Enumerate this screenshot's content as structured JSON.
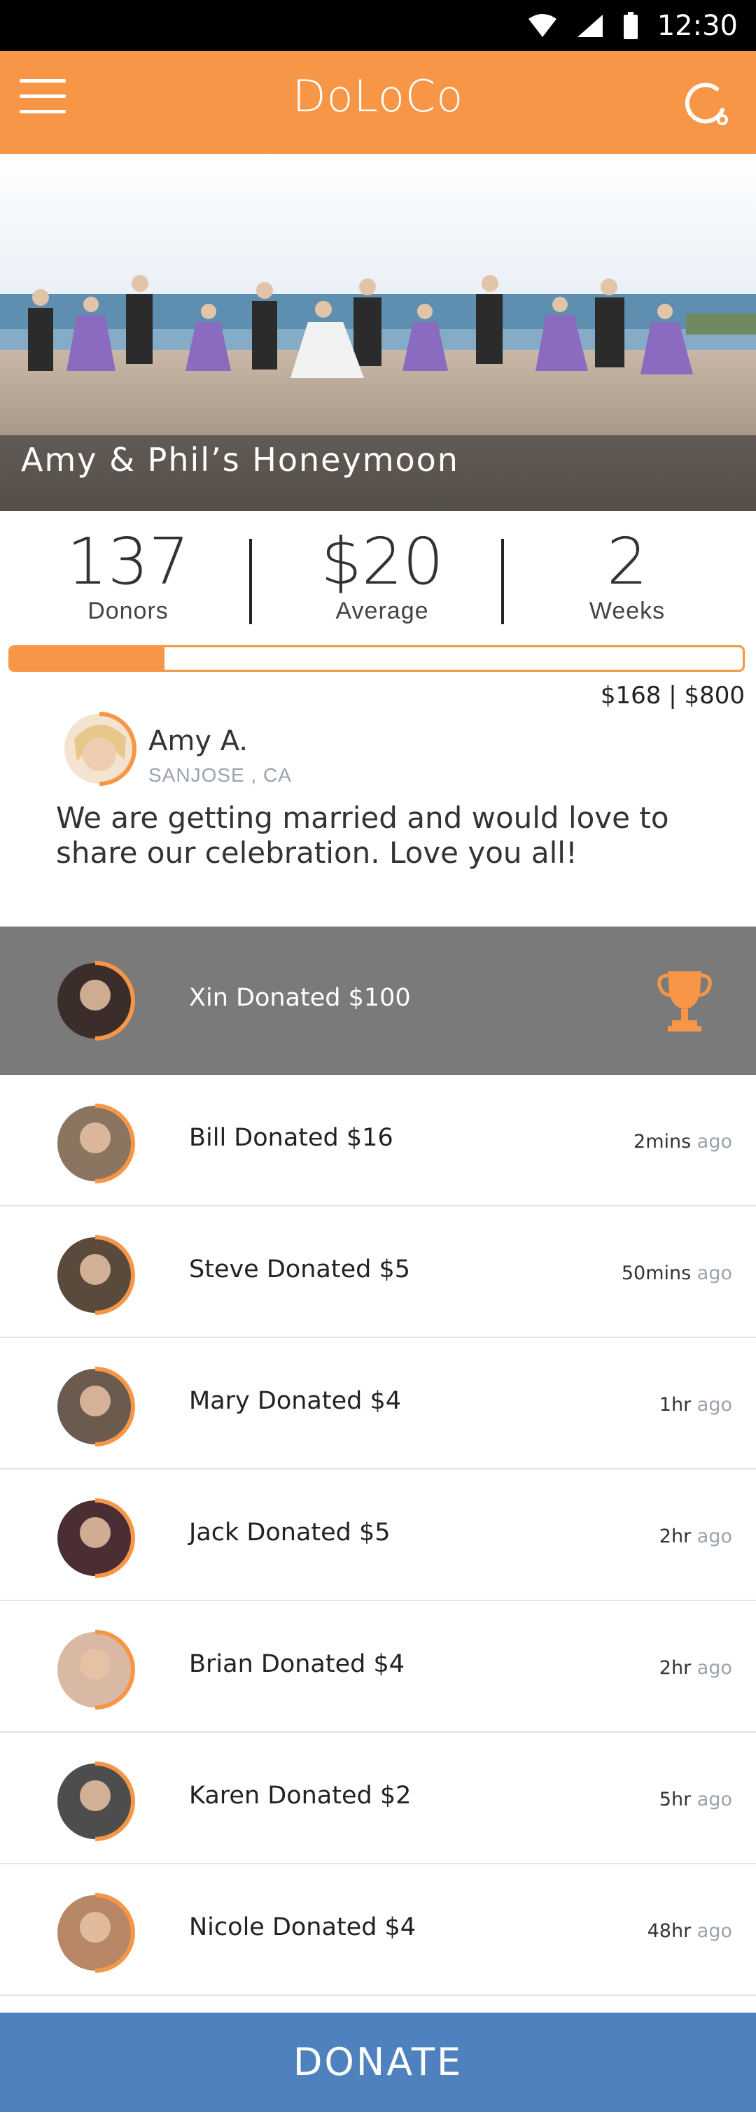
{
  "status_bar": {
    "time": "12:30",
    "icons": [
      "wifi-icon",
      "signal-icon",
      "battery-icon"
    ]
  },
  "app_bar": {
    "title": "DoLoCo",
    "menu_icon": "hamburger-menu-icon",
    "refresh_icon": "refresh-icon"
  },
  "campaign": {
    "title": "Amy & Phil’s Honeymoon",
    "stats": [
      {
        "value": "137",
        "label": "Donors"
      },
      {
        "value": "$20",
        "label": "Average"
      },
      {
        "value": "2",
        "label": "Weeks"
      }
    ],
    "progress": {
      "raised": 168,
      "goal": 800,
      "text": "$168 | $800"
    }
  },
  "organizer": {
    "name": "Amy A.",
    "location": "SANJOSE , CA",
    "message": "We are getting married and would love to share our celebration. Love you all!"
  },
  "donations": [
    {
      "text": "Xin Donated $100",
      "time": "",
      "ago": "",
      "top_donor": true,
      "avatar_color": "#3b2e2a"
    },
    {
      "text": "Bill Donated $16",
      "time": "2mins",
      "ago": "ago",
      "top_donor": false,
      "avatar_color": "#8a7560"
    },
    {
      "text": "Steve Donated $5",
      "time": "50mins",
      "ago": "ago",
      "top_donor": false,
      "avatar_color": "#5a4a3c"
    },
    {
      "text": "Mary Donated $4",
      "time": "1hr",
      "ago": "ago",
      "top_donor": false,
      "avatar_color": "#6b5a4e"
    },
    {
      "text": "Jack Donated $5",
      "time": "2hr",
      "ago": "ago",
      "top_donor": false,
      "avatar_color": "#4a2e34"
    },
    {
      "text": "Brian Donated $4",
      "time": "2hr",
      "ago": "ago",
      "top_donor": false,
      "avatar_color": "#d9b9a4"
    },
    {
      "text": "Karen Donated $2",
      "time": "5hr",
      "ago": "ago",
      "top_donor": false,
      "avatar_color": "#4d4d4d"
    },
    {
      "text": "Nicole Donated $4",
      "time": "48hr",
      "ago": "ago",
      "top_donor": false,
      "avatar_color": "#b88866"
    }
  ],
  "donate_button": {
    "label": "DONATE"
  },
  "colors": {
    "accent": "#f79646",
    "donate_blue": "#4e81bd",
    "top_row_gray": "#7a7a7a"
  }
}
